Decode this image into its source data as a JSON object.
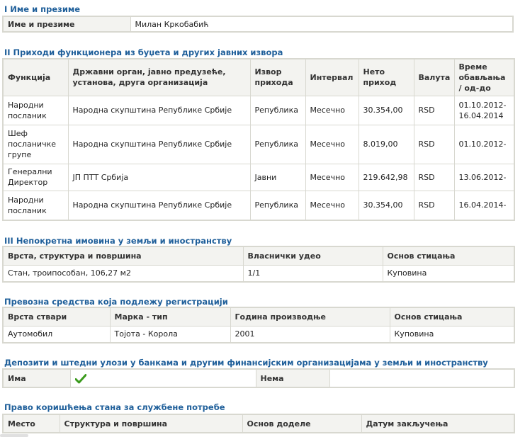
{
  "section1": {
    "title": "I Име и презиме",
    "label": "Име и презиме",
    "value": "Милан Кркобабић"
  },
  "section2": {
    "title": "II Приходи функционера из буџета и других јавних извора",
    "headers": [
      "Функција",
      "Државни орган, јавно предузеће, установа, друга организација",
      "Извор прихода",
      "Интервал",
      "Нето приход",
      "Валута",
      "Време обављања / од-до"
    ],
    "rows": [
      [
        "Народни посланик",
        "Народна скупштина Републике Србије",
        "Република",
        "Месечно",
        "30.354,00",
        "RSD",
        "01.10.2012-16.04.2014"
      ],
      [
        "Шеф посланичке групе",
        "Народна скупштина Републике Србије",
        "Република",
        "Месечно",
        "8.019,00",
        "RSD",
        "01.10.2012-"
      ],
      [
        "Генерални Директор",
        "ЈП ПТТ Србија",
        "Јавни",
        "Месечно",
        "219.642,98",
        "RSD",
        "13.06.2012-"
      ],
      [
        "Народни посланик",
        "Народна скупштина Републике Србије",
        "Република",
        "Месечно",
        "30.354,00",
        "RSD",
        "16.04.2014-"
      ]
    ]
  },
  "section3": {
    "title": "III Непокретна имовина у земљи и иностранству",
    "headers": [
      "Врста, структура и површина",
      "Власнички удео",
      "Основ стицања"
    ],
    "rows": [
      [
        "Стан, троипособан, 106,27 м2",
        "1/1",
        "Куповина"
      ]
    ]
  },
  "section4": {
    "title": "Превозна средства која подлежу регистрацији",
    "headers": [
      "Врста ствари",
      "Марка - тип",
      "Година производње",
      "Основ стицања"
    ],
    "rows": [
      [
        "Аутомобил",
        "Тојота - Корола",
        "2001",
        "Куповина"
      ]
    ]
  },
  "section5": {
    "title": "Депозити и штедни улози у банкама и другим финансијским организацијама у земљи и иностранству",
    "yes_label": "Има",
    "yes_icon": "check-icon",
    "yes_checked": true,
    "no_label": "Нема",
    "check_color": "#3a9a1c"
  },
  "section6": {
    "title": "Право коришћења стана за службене потребе",
    "headers": [
      "Место",
      "Структура и површина",
      "Основ доделе",
      "Датум закључења"
    ]
  }
}
